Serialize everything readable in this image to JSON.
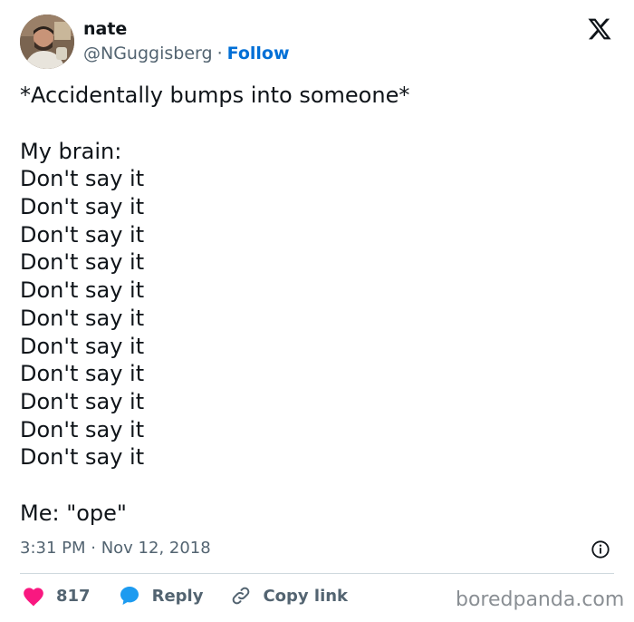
{
  "author": {
    "display_name": "nate",
    "handle": "@NGuggisberg",
    "separator": "·",
    "follow_label": "Follow"
  },
  "tweet": {
    "lines": [
      "*Accidentally bumps into someone*",
      "",
      "My brain:",
      "Don't say it",
      "Don't say it",
      "Don't say it",
      "Don't say it",
      "Don't say it",
      "Don't say it",
      "Don't say it",
      "Don't say it",
      "Don't say it",
      "Don't say it",
      "Don't say it",
      "",
      "Me: \"ope\""
    ],
    "timestamp": "3:31 PM · Nov 12, 2018"
  },
  "actions": {
    "like_count": "817",
    "reply_label": "Reply",
    "copy_link_label": "Copy link"
  },
  "icons": {
    "brand": "x-logo-icon",
    "info": "info-icon",
    "like": "heart-icon",
    "reply": "speech-bubble-icon",
    "copy": "link-icon"
  },
  "colors": {
    "text": "#0f1419",
    "muted": "#536471",
    "follow": "#006fd6",
    "like": "#f91880",
    "reply": "#1d9bf0",
    "watermark": "#8a8f94"
  },
  "watermark": "boredpanda.com"
}
